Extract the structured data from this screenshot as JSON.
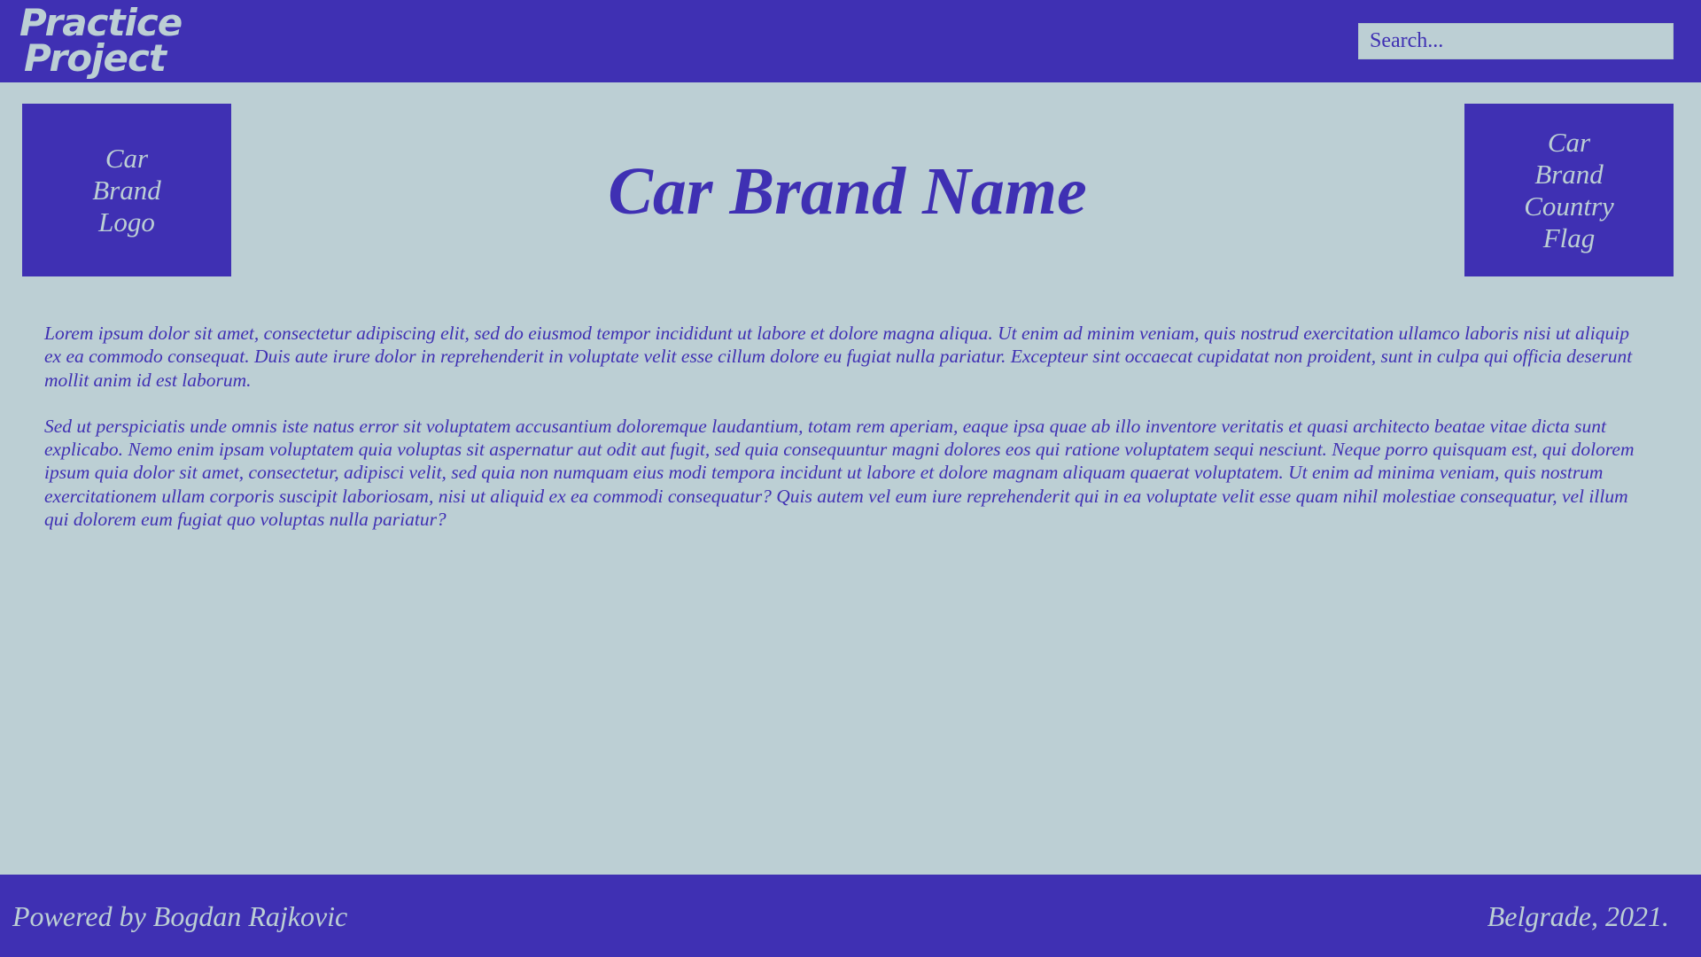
{
  "header": {
    "brand_title": "Practice\nProject",
    "search_placeholder": "Search..."
  },
  "hero": {
    "logo_label": "Car Brand Logo",
    "title": "Car Brand Name",
    "flag_label": "Car Brand Country Flag"
  },
  "content": {
    "paragraphs": [
      "Lorem ipsum dolor sit amet, consectetur adipiscing elit, sed do eiusmod tempor incididunt ut labore et dolore magna aliqua. Ut enim ad minim veniam, quis nostrud exercitation ullamco laboris nisi ut aliquip ex ea commodo consequat. Duis aute irure dolor in reprehenderit in voluptate velit esse cillum dolore eu fugiat nulla pariatur. Excepteur sint occaecat cupidatat non proident, sunt in culpa qui officia deserunt mollit anim id est laborum.",
      "Sed ut perspiciatis unde omnis iste natus error sit voluptatem accusantium doloremque laudantium, totam rem aperiam, eaque ipsa quae ab illo inventore veritatis et quasi architecto beatae vitae dicta sunt explicabo. Nemo enim ipsam voluptatem quia voluptas sit aspernatur aut odit aut fugit, sed quia consequuntur magni dolores eos qui ratione voluptatem sequi nesciunt. Neque porro quisquam est, qui dolorem ipsum quia dolor sit amet, consectetur, adipisci velit, sed quia non numquam eius modi tempora incidunt ut labore et dolore magnam aliquam quaerat voluptatem. Ut enim ad minima veniam, quis nostrum exercitationem ullam corporis suscipit laboriosam, nisi ut aliquid ex ea commodi consequatur? Quis autem vel eum iure reprehenderit qui in ea voluptate velit esse quam nihil molestiae consequatur, vel illum qui dolorem eum fugiat quo voluptas nulla pariatur?"
    ]
  },
  "footer": {
    "left_text": "Powered by Bogdan Rajkovic",
    "right_text": "Belgrade, 2021."
  },
  "colors": {
    "primary": "#3f30b3",
    "background": "#bccfd4"
  }
}
